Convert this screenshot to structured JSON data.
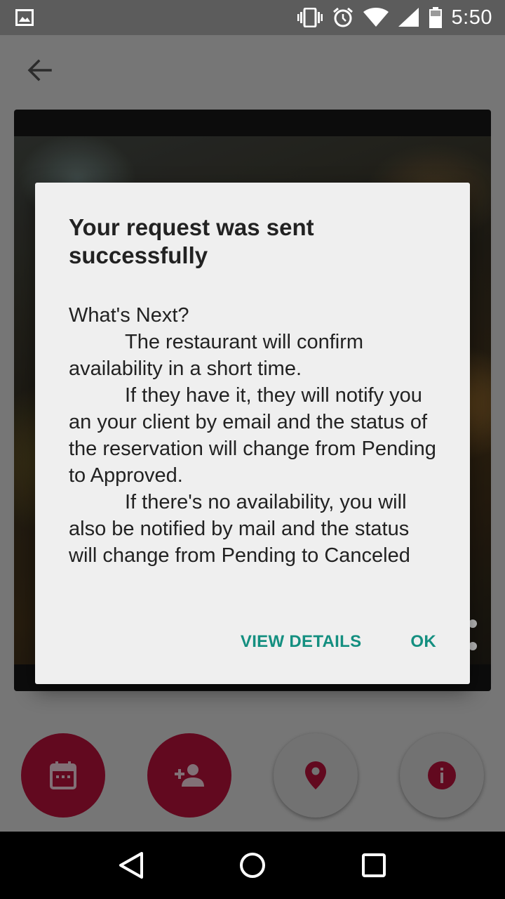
{
  "status_bar": {
    "time": "5:50",
    "icons": [
      "image-notification-icon",
      "vibrate-icon",
      "alarm-icon",
      "wifi-icon",
      "cell-signal-icon",
      "battery-icon"
    ]
  },
  "app_bar": {
    "back_icon": "arrow-back-icon"
  },
  "dialog": {
    "title": "Your request was sent successfully",
    "body": {
      "heading": "What's Next?",
      "para1": "The restaurant will confirm availability in a short time.",
      "para2": "If they have it, they will notify you an your client by email and the status of the reservation will change from Pending  to Approved.",
      "para3": "If there's no availability, you will also be notified by mail and the status will change from Pending to Canceled"
    },
    "actions": {
      "view_details": "VIEW DETAILS",
      "ok": "OK"
    }
  },
  "bottom_actions": [
    {
      "icon": "calendar-icon",
      "style": "filled"
    },
    {
      "icon": "add-person-icon",
      "style": "filled"
    },
    {
      "icon": "location-pin-icon",
      "style": "outline"
    },
    {
      "icon": "info-icon",
      "style": "outline"
    }
  ],
  "nav_bar": {
    "icons": [
      "back-triangle-icon",
      "home-circle-icon",
      "recents-square-icon"
    ]
  },
  "colors": {
    "accent": "#148f80",
    "brand": "#6b0a22",
    "dialog_bg": "#efefef"
  }
}
